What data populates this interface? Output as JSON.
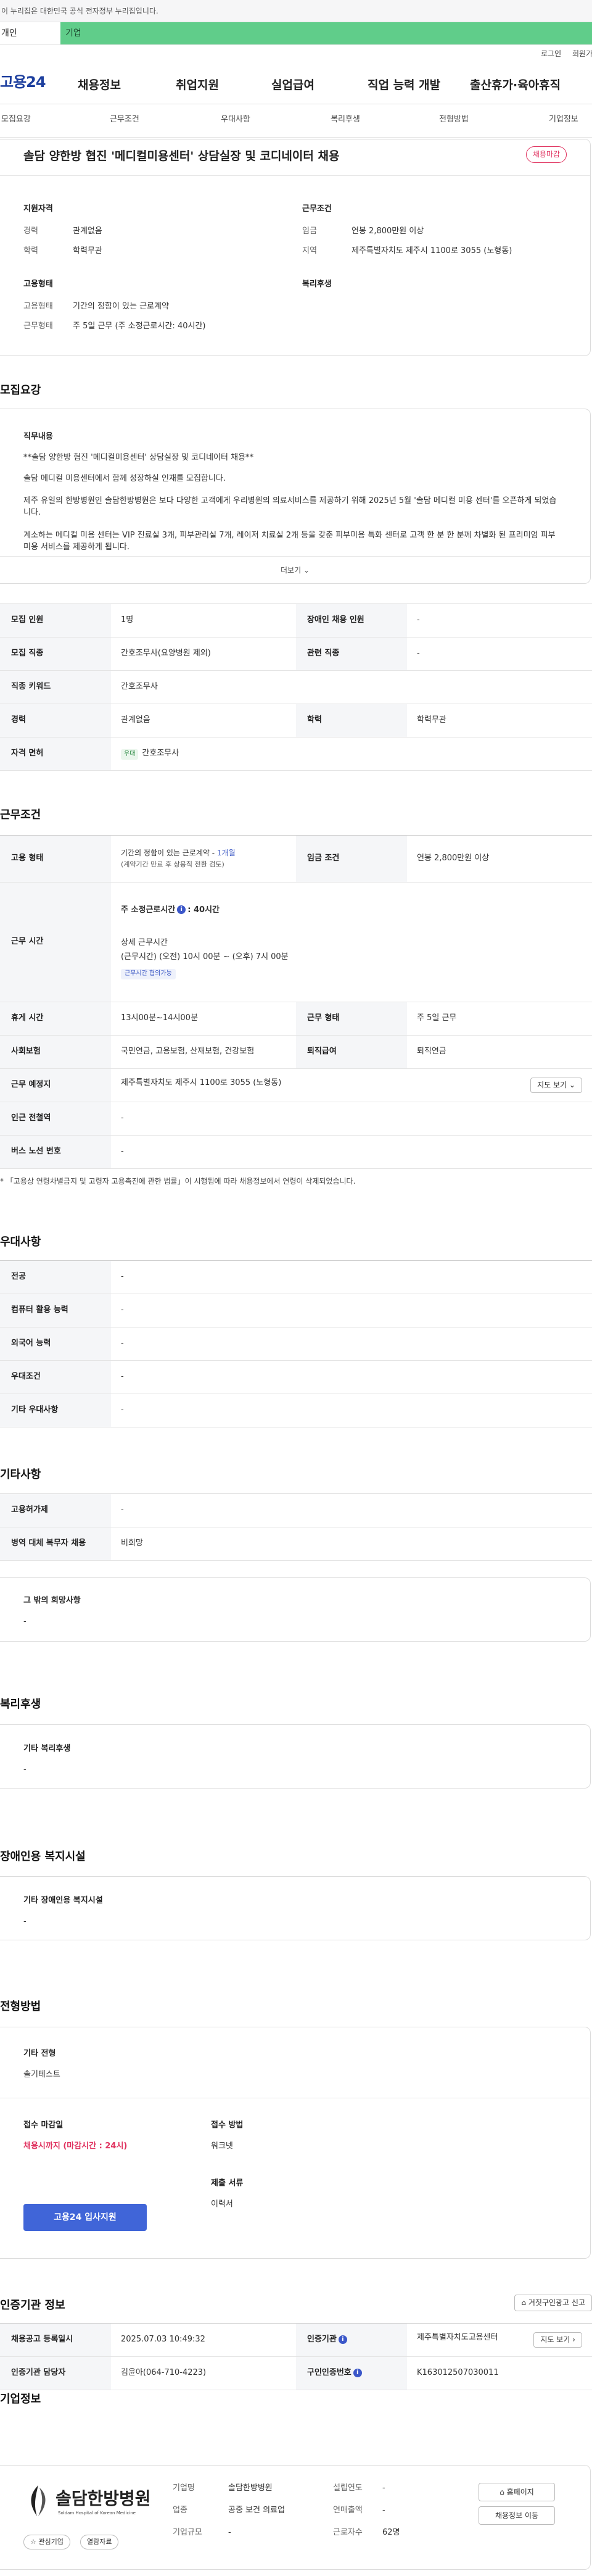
{
  "notice": "이 누리집은 대한민국 공식 전자정부 누리집입니다.",
  "top_tabs": [
    "개인",
    "기업"
  ],
  "util": {
    "login": "로그인",
    "signup": "회원가입"
  },
  "header": {
    "logo": "고용24",
    "menu": [
      "채용정보",
      "취업지원",
      "실업급여",
      "직업 능력 개발",
      "출산휴가·육아휴직"
    ]
  },
  "anchors": [
    "모집요강",
    "근무조건",
    "우대사항",
    "복리후생",
    "전형방법",
    "기업정보"
  ],
  "summary": {
    "title": "솔담 양한방 협진 '메디컬미용센터' 상담실장 및 코디네이터 채용",
    "status_badge": "채용마감",
    "qual_title": "지원자격",
    "career_label": "경력",
    "career_value": "관계없음",
    "edu_label": "학력",
    "edu_value": "학력무관",
    "cond_title": "근무조건",
    "wage_label": "임금",
    "wage_value": "연봉 2,800만원 이상",
    "loc_label": "지역",
    "loc_value": "제주특별자치도 제주시 1100로 3055 (노형동)",
    "emp_title": "고용형태",
    "emp_type_label": "고용형태",
    "emp_type_value": "기간의 정함이 있는 근로계약",
    "work_form_label": "근무형태",
    "work_form_value": "주 5일 근무 (주 소정근로시간: 40시간)",
    "welfare_title": "복리후생"
  },
  "recruit": {
    "section_title": "모집요강",
    "detail_title": "직무내용",
    "lines": [
      "**솔담 양한방 협진 '메디컬미용센터' 상담실장 및 코디네이터 채용**",
      "솔담 메디컬 미용센터에서 함께 성장하실 인재를 모집합니다.",
      "제주 유일의 한방병원인 솔담한방병원은 보다 다양한 고객에게 우리병원의 의료서비스를 제공하기 위해 2025년 5월 '솔담 메디컬 미용 센터'를 오픈하게 되었습니다.",
      "계소하는 메디컬 미용 센터는 VIP 진료실 3개, 피부관리실 7개, 레이저 치료실 2개 등을 갖춘 피부미용 특화 센터로 고객 한 분 한 분께 차별화 된 프리미엄 피부미용 서비스를 제공하게 됩니다."
    ],
    "more_label": "더보기"
  },
  "recruit_table": {
    "count_label": "모집 인원",
    "count_value": "1명",
    "disabled_label": "장애인 채용 인원",
    "disabled_value": "-",
    "job_label": "모집 직종",
    "job_value": "간호조무사(요양병원 제외)",
    "related_label": "관련 직종",
    "related_value": "-",
    "keyword_label": "직종 키워드",
    "keyword_value": "간호조무사",
    "career_label": "경력",
    "career_value": "관계없음",
    "edu_label": "학력",
    "edu_value": "학력무관",
    "license_label": "자격 면허",
    "license_chip": "우대",
    "license_value": "간호조무사"
  },
  "conditions": {
    "section_title": "근무조건",
    "emp_label": "고용 형태",
    "emp_value": "기간의 정함이 있는 근로계약 - ",
    "emp_months": "1개월",
    "emp_note": "(계약기간 만료 후 상용직 전환 검토)",
    "wage_label": "임금 조건",
    "wage_value": "연봉 2,800만원 이상",
    "hours_label": "근무 시간",
    "hours_weekly": "주 소정근로시간",
    "hours_weekly_value": ": 40시간",
    "hours_detail_title": "상세 근무시간",
    "hours_detail": "(근무시간) (오전) 10시 00분 ~ (오후) 7시 00분",
    "hours_chip": "근무시간 협의가능",
    "rest_label": "휴게 시간",
    "rest_value": "13시00분~14시00분",
    "form_label": "근무 형태",
    "form_value": "주 5일 근무",
    "ins_label": "사회보험",
    "ins_value": "국민연금, 고용보험, 산재보험, 건강보험",
    "retire_label": "퇴직급여",
    "retire_value": "퇴직연금",
    "place_label": "근무 예정지",
    "place_value": "제주특별자치도 제주시 1100로 3055 (노형동)",
    "map_btn": "지도 보기 ⌄",
    "subway_label": "인근 전철역",
    "subway_value": "-",
    "bus_label": "버스 노선 번호",
    "bus_value": "-",
    "footnote": "* 「고용상 연령차별금지 및 고령자 고용촉진에 관한 법률」이 시행됨에 따라 채용정보에서 연령이 삭제되었습니다."
  },
  "preference": {
    "section_title": "우대사항",
    "rows": [
      {
        "label": "전공",
        "value": "-"
      },
      {
        "label": "컴퓨터 활용 능력",
        "value": "-"
      },
      {
        "label": "외국어 능력",
        "value": "-"
      },
      {
        "label": "우대조건",
        "value": "-"
      },
      {
        "label": "기타 우대사항",
        "value": "-"
      }
    ]
  },
  "etc": {
    "section_title": "기타사항",
    "rows": [
      {
        "label": "고용허가제",
        "value": "-"
      },
      {
        "label": "병역 대체 복무자 채용",
        "value": "비희망"
      }
    ],
    "hope_title": "그 밖의 희망사항",
    "hope_value": "-"
  },
  "welfare": {
    "section_title": "복리후생",
    "box_title": "기타 복리후생",
    "box_value": "-"
  },
  "disabled": {
    "section_title": "장애인용 복지시설",
    "box_title": "기타 장애인용 복지시설",
    "box_value": "-"
  },
  "process": {
    "section_title": "전형방법",
    "etc_title": "기타 전형",
    "etc_value": "솔기테스트",
    "deadline_title": "접수 마감일",
    "deadline_value": "채용시까지 (마감시간 : 24시)",
    "method_title": "접수 방법",
    "method_value": "워크넷",
    "docs_title": "제출 서류",
    "docs_value": "이력서",
    "apply_btn": "고용24 입사지원"
  },
  "agency": {
    "section_title": "인증기관 정보",
    "report_btn": "거짓구인광고 신고",
    "reg_label": "채용공고 등록일시",
    "reg_value": "2025.07.03 10:49:32",
    "org_label": "인증기관",
    "org_value": "제주특별자치도고용센터",
    "map_btn": "지도 보기 ›",
    "manager_label": "인증기관 담당자",
    "manager_value": "김윤아(064-710-4223)",
    "no_label": "구인인증번호",
    "no_value": "K163012507030011"
  },
  "company": {
    "section_title": "기업정보",
    "logo_text": "솔담한방병원",
    "logo_sub": "Soldam Hospital of Korean Medicine",
    "name_label": "기업명",
    "name_value": "솔담한방병원",
    "industry_label": "업종",
    "industry_value": "공중 보건 의료업",
    "size_label": "기업규모",
    "size_value": "-",
    "founded_label": "설립연도",
    "founded_value": "-",
    "sales_label": "연매출액",
    "sales_value": "-",
    "staff_label": "근로자수",
    "staff_value": "62명",
    "interest_btn": "☆ 관심기업",
    "view_btn": "열람자료",
    "homepage_btn": "홈페이지",
    "list_btn": "채용정보 이동"
  }
}
